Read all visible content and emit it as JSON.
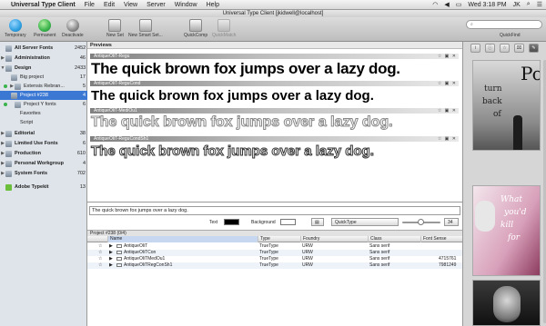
{
  "menubar": {
    "app_name": "Universal Type Client",
    "items": [
      "File",
      "Edit",
      "View",
      "Server",
      "Window",
      "Help"
    ],
    "clock": "Wed 3:18 PM",
    "user": "JK"
  },
  "window": {
    "title": "Universal Type Client [jkidwell@localhost]"
  },
  "toolbar": {
    "temporary": "Temporary",
    "permanent": "Permanent",
    "deactivate": "Deactivate",
    "new_set": "New Set",
    "new_smart_set": "New Smart Set...",
    "quickcomp": "QuickComp",
    "quickmatch": "QuickMatch",
    "quickfind": "QuickFind",
    "colors": {
      "temporary": "#2e9fe0",
      "permanent": "#39b34a",
      "deactivate": "#8a8a8a"
    }
  },
  "sidebar": {
    "items": [
      {
        "label": "All Server Fonts",
        "count": "2452",
        "group": true
      },
      {
        "label": "Administration",
        "count": "46",
        "group": true
      },
      {
        "label": "Design",
        "count": "2433",
        "group": true
      },
      {
        "label": "Big project",
        "count": "17"
      },
      {
        "label": "Extensis Rebran...",
        "count": "5"
      },
      {
        "label": "Project #238",
        "count": "4"
      },
      {
        "label": "Project Y fonts",
        "count": "6"
      },
      {
        "label": "Favorites",
        "count": ""
      },
      {
        "label": "Script",
        "count": ""
      },
      {
        "label": "Editorial",
        "count": "38",
        "group": true
      },
      {
        "label": "Limited Use Fonts",
        "count": "6",
        "group": true
      },
      {
        "label": "Production",
        "count": "610",
        "group": true
      },
      {
        "label": "Personal Workgroup",
        "count": "4",
        "group": true
      },
      {
        "label": "System Fonts",
        "count": "702",
        "group": true
      },
      {
        "label": "Adobe Typekit",
        "count": "13",
        "group": true
      }
    ]
  },
  "previews": {
    "header": "Previews",
    "sample_text": "The quick brown fox jumps over a lazy dog.",
    "fonts": [
      "AntiqueOliT-Regu",
      "AntiqueOliT-ReguCond",
      "AntiqueOliT-MediOu1",
      "AntiqueOliT-ReguCondSh1"
    ]
  },
  "controls": {
    "sample_input": "The quick brown fox jumps over a lazy dog.",
    "text_label": "Text",
    "background_label": "Background",
    "mode": "QuickType",
    "size": "34",
    "text_color": "#000000",
    "background_color": "#ffffff",
    "size_slider_level": 0.48
  },
  "project": {
    "header": "Project #238 (0/4)",
    "columns": [
      "Name",
      "Type",
      "Foundry",
      "Class",
      "Font Sense"
    ],
    "rows": [
      {
        "name": "AntiqueOliT",
        "type": "TrueType",
        "foundry": "URW",
        "class": "Sans serif",
        "sense": ""
      },
      {
        "name": "AntiqueOliTCon",
        "type": "TrueType",
        "foundry": "URW",
        "class": "Sans serif",
        "sense": ""
      },
      {
        "name": "AntiqueOliTMedOu1",
        "type": "TrueType",
        "foundry": "URW",
        "class": "Sans serif",
        "sense": "4715761"
      },
      {
        "name": "AntiqueOliTRegConSh1",
        "type": "TrueType",
        "foundry": "URW",
        "class": "Sans serif",
        "sense": "7981249"
      }
    ]
  },
  "rightpanel": {
    "tabs": [
      "i",
      "ⓘ",
      "☆",
      "⌧",
      "✎"
    ],
    "covers": [
      {
        "title": "Po",
        "lines": [
          "turn",
          "back",
          "of"
        ]
      },
      {
        "title": "",
        "lines": [
          "What",
          "you'd",
          "kill",
          "for"
        ]
      },
      {
        "title": "",
        "lines": []
      }
    ]
  }
}
